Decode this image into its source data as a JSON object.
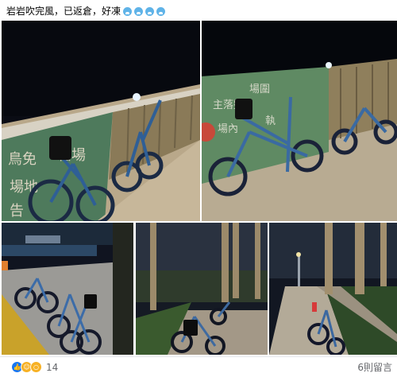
{
  "post": {
    "text": "岩岩吹完風，已返倉，好凍",
    "emojis": [
      "cold-face",
      "cold-face",
      "cold-face",
      "cold-face"
    ]
  },
  "photos": [
    {
      "id": "photo-1",
      "banner_text": "鳥免 鬆場 場地內"
    },
    {
      "id": "photo-2",
      "banner_text": "主落整 場圍內 場內・執"
    },
    {
      "id": "photo-3"
    },
    {
      "id": "photo-4"
    },
    {
      "id": "photo-5"
    }
  ],
  "footer": {
    "reaction_count": "14",
    "reactions": [
      "like",
      "haha",
      "wow"
    ],
    "comments_label": "6則留言"
  },
  "colors": {
    "like": "#1877f2",
    "haha": "#f7b125",
    "meta_text": "#65676b"
  }
}
